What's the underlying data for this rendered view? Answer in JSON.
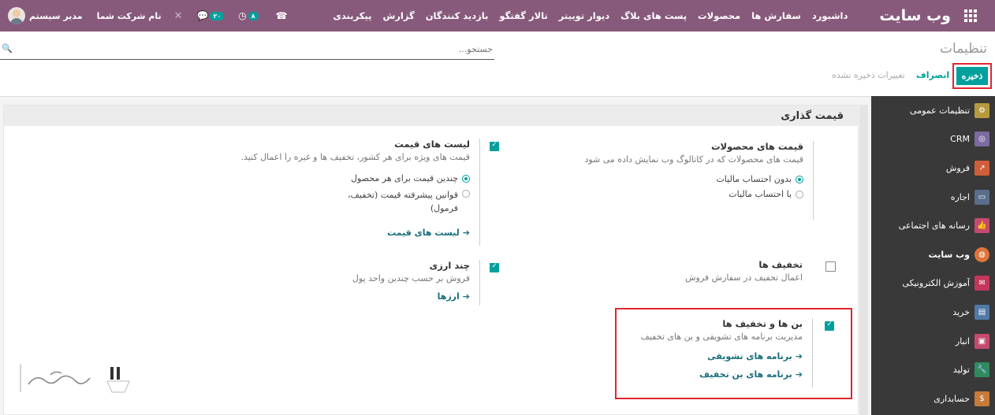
{
  "navbar": {
    "brand": "وب سایت",
    "menu": [
      "داشبورد",
      "سفارش ها",
      "محصولات",
      "پست های بلاگ",
      "دیوار توییتر",
      "تالار گفتگو",
      "بازدید کنندگان",
      "گزارش",
      "پیکربندی"
    ],
    "user": "مدیر سیستم",
    "company": "نام شرکت شما",
    "activity_badge": "۸",
    "messages_badge": "۲۰"
  },
  "page": {
    "title": "تنظیمات",
    "search_placeholder": "جستجو...",
    "save_label": "ذخیره",
    "discard_label": "انصراف",
    "unsaved_label": "تغییرات ذخیره نشده"
  },
  "sidebar": {
    "items": [
      {
        "label": "تنظیمات عمومی",
        "icon": "gear-icon",
        "color": "#b69a3d"
      },
      {
        "label": "CRM",
        "icon": "handshake-icon",
        "color": "#7c6aa0"
      },
      {
        "label": "فروش",
        "icon": "chart-icon",
        "color": "#d05e38"
      },
      {
        "label": "اجاره",
        "icon": "card-icon",
        "color": "#5a6d8c"
      },
      {
        "label": "رسانه های اجتماعی",
        "icon": "thumbs-up-icon",
        "color": "#c44b6d"
      },
      {
        "label": "وب سایت",
        "icon": "globe-icon",
        "color": "#e0743a"
      },
      {
        "label": "آموزش الکترونیکی",
        "icon": "chat-icon",
        "color": "#c3375b"
      },
      {
        "label": "خرید",
        "icon": "credit-card-icon",
        "color": "#4f7aa6"
      },
      {
        "label": "انبار",
        "icon": "box-icon",
        "color": "#c44b6d"
      },
      {
        "label": "تولید",
        "icon": "wrench-icon",
        "color": "#2f8a5e"
      },
      {
        "label": "حسابداری",
        "icon": "invoice-icon",
        "color": "#c77a3a"
      }
    ]
  },
  "section": {
    "title": "قیمت گذاری",
    "product_prices": {
      "label": "قیمت های محصولات",
      "desc": "قیمت های محصولات که در کاتالوگ وب نمایش داده می شود",
      "options": [
        "بدون احتساب مالیات",
        "با احتساب مالیات"
      ]
    },
    "pricelists": {
      "label": "لیست های قیمت",
      "desc": "قیمت های ویژه برای هر کشور، تخفیف ها و غیره را اعمال کنید.",
      "options": [
        "چندین قیمت برای هر محصول",
        "قوانین پیشرفته قیمت (تخفیف، فرمول)"
      ],
      "link": "لیست های قیمت"
    },
    "discounts": {
      "label": "تخفیف ها",
      "desc": "اعمال تخفیف در سفارش فروش"
    },
    "multi_currency": {
      "label": "چند ارزی",
      "desc": "فروش بر حسب چندین واحد پول",
      "link": "ارزها"
    },
    "coupons": {
      "label": "بن ها و تخفیف ها",
      "desc": "مدیریت برنامه های تشویقی و بن های تخفیف",
      "link1": "برنامه های تشویقی",
      "link2": "برنامه های بن تخفیف"
    }
  },
  "colors": {
    "navbar": "#875a7b",
    "accent": "#00a09d",
    "highlight": "#e0262d"
  }
}
